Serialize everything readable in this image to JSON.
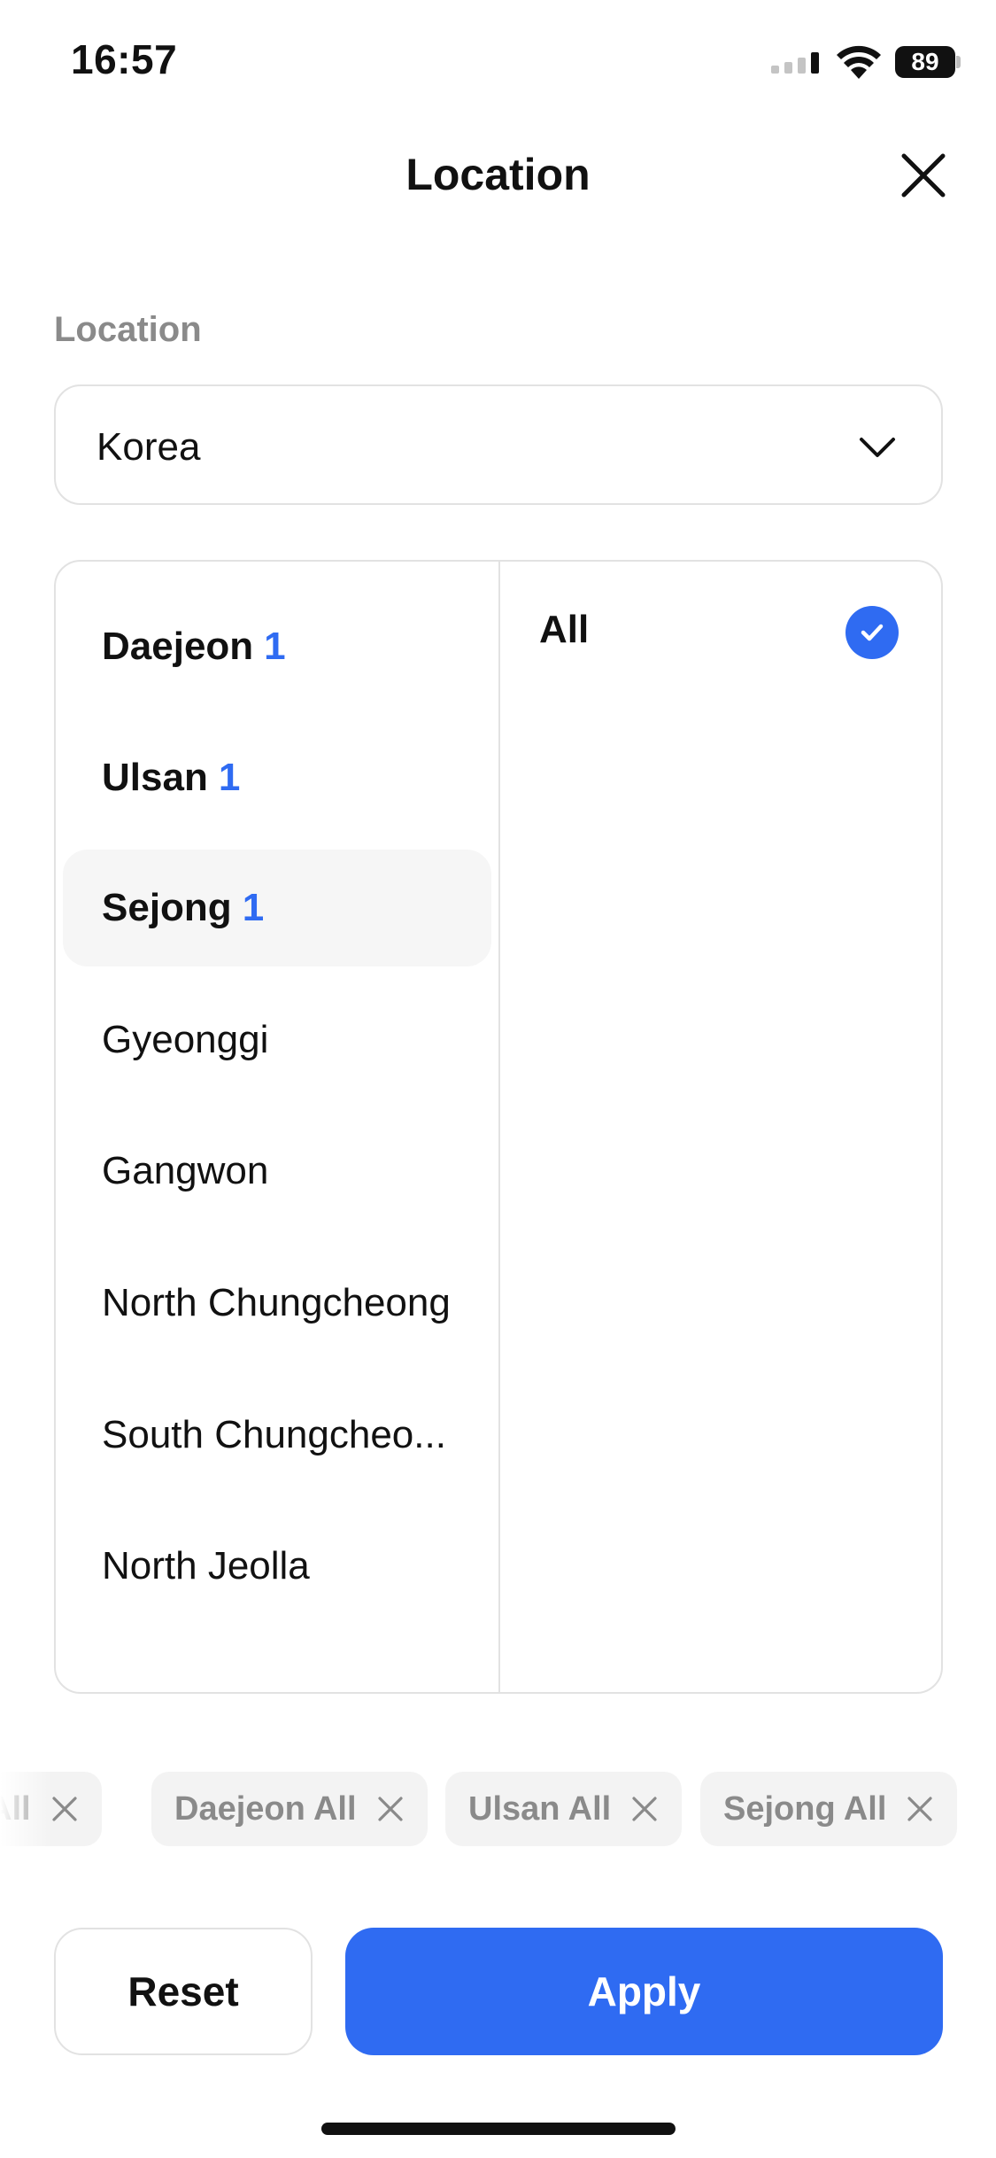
{
  "status_bar": {
    "time": "16:57",
    "battery": "89"
  },
  "header": {
    "title": "Location"
  },
  "location_field": {
    "label": "Location",
    "value": "Korea"
  },
  "regions": [
    {
      "name": "Daejeon",
      "count": "1",
      "bold": true,
      "selected": false
    },
    {
      "name": "Ulsan",
      "count": "1",
      "bold": true,
      "selected": false
    },
    {
      "name": "Sejong",
      "count": "1",
      "bold": true,
      "selected": true
    },
    {
      "name": "Gyeonggi",
      "count": "",
      "bold": false,
      "selected": false
    },
    {
      "name": "Gangwon",
      "count": "",
      "bold": false,
      "selected": false
    },
    {
      "name": "North Chungcheong",
      "count": "",
      "bold": false,
      "selected": false
    },
    {
      "name": "South Chungcheo...",
      "count": "",
      "bold": false,
      "selected": false
    },
    {
      "name": "North Jeolla",
      "count": "",
      "bold": false,
      "selected": false
    }
  ],
  "sub_regions": [
    {
      "label": "All",
      "checked": true
    }
  ],
  "chips": [
    {
      "label": "All"
    },
    {
      "label": "Daejeon All"
    },
    {
      "label": "Ulsan All"
    },
    {
      "label": "Sejong All"
    }
  ],
  "buttons": {
    "reset": "Reset",
    "apply": "Apply"
  },
  "colors": {
    "accent": "#2f6bf2",
    "border": "#e2e2e2",
    "muted": "#8a8a8a",
    "selected_bg": "#f6f6f6",
    "chip_bg": "#f3f3f3"
  }
}
